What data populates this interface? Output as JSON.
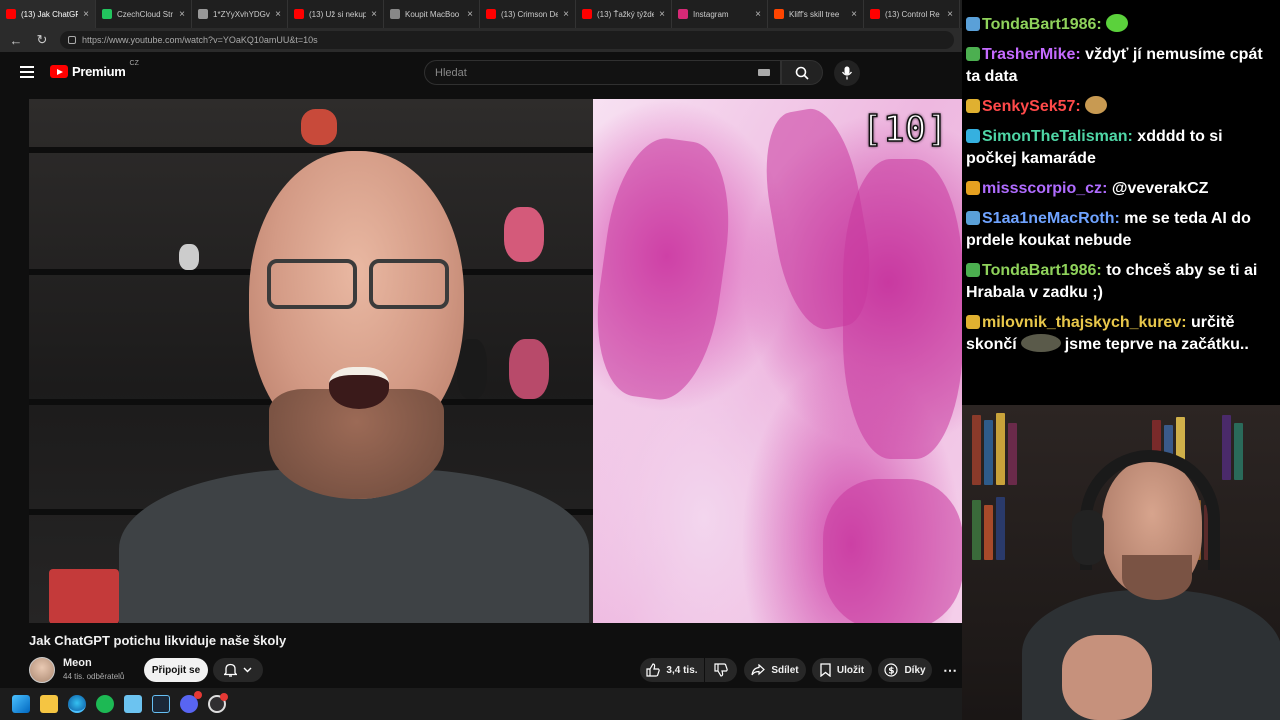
{
  "browser": {
    "tabs": [
      {
        "label": "(13) Jak ChatGP",
        "favicon": "youtube-icon",
        "color": "#ff0000",
        "active": true
      },
      {
        "label": "CzechCloud Str",
        "favicon": "czechcloud-icon",
        "color": "#22c55e"
      },
      {
        "label": "1*ZYyXvhYDGv",
        "favicon": "globe-icon",
        "color": "#999999"
      },
      {
        "label": "(13) Už si nekup",
        "favicon": "youtube-icon",
        "color": "#ff0000"
      },
      {
        "label": "Koupit MacBoo",
        "favicon": "apple-icon",
        "color": "#888888"
      },
      {
        "label": "(13) Crimson De",
        "favicon": "youtube-icon",
        "color": "#ff0000"
      },
      {
        "label": "(13) Ťažký týžde",
        "favicon": "youtube-icon",
        "color": "#ff0000"
      },
      {
        "label": "Instagram",
        "favicon": "instagram-icon",
        "color": "#d62976"
      },
      {
        "label": "Kliff's skill tree",
        "favicon": "reddit-icon",
        "color": "#ff4500"
      },
      {
        "label": "(13) Control Re",
        "favicon": "youtube-icon",
        "color": "#ff0000"
      }
    ],
    "url": "https://www.youtube.com/watch?v=YOaKQ10amUU&t=10s"
  },
  "youtube": {
    "logo_text": "Premium",
    "logo_country": "CZ",
    "search_placeholder": "Hledat",
    "video_counter": "[10]",
    "title": "Jak ChatGPT potichu likviduje naše školy",
    "channel_name": "Meon",
    "subscribers": "44 tis. odběratelů",
    "join_label": "Připojit se",
    "like_count": "3,4 tis.",
    "share_label": "Sdílet",
    "save_label": "Uložit",
    "thanks_label": "Díky",
    "more_label": "⋯"
  },
  "chat": {
    "messages": [
      {
        "user": "TondaBart1986",
        "color": "#8fd25b",
        "text": "",
        "emote": "green-blob-emote"
      },
      {
        "user": "TrasherMike",
        "color": "#c56bff",
        "text": "vždyť jí nemusíme cpát ta data"
      },
      {
        "user": "SenkySek57",
        "color": "#ff4a4a",
        "text": "",
        "emote": "cookie-emote"
      },
      {
        "user": "SimonTheTalisman",
        "color": "#4fd6a6",
        "text": "xdddd to si počkej kamaráde"
      },
      {
        "user": "missscorpio_cz",
        "color": "#b06cff",
        "text": "@veverakCZ"
      },
      {
        "user": "S1aa1neMacRoth",
        "color": "#6fa3ff",
        "text": "me se teda AI do prdele koukat nebude"
      },
      {
        "user": "TondaBart1986",
        "color": "#8fd25b",
        "text": "to chceš aby se ti ai Hrabala v zadku ;)"
      },
      {
        "user": "milovnik_thajskych_kurev",
        "color": "#e8c74a",
        "text": "určitě skončí",
        "text2": "jsme teprve na začátku.."
      }
    ]
  },
  "colors": {
    "yt_bg": "#0f0f0f",
    "accent_red": "#ff0000",
    "chat_bg": "#000000"
  }
}
